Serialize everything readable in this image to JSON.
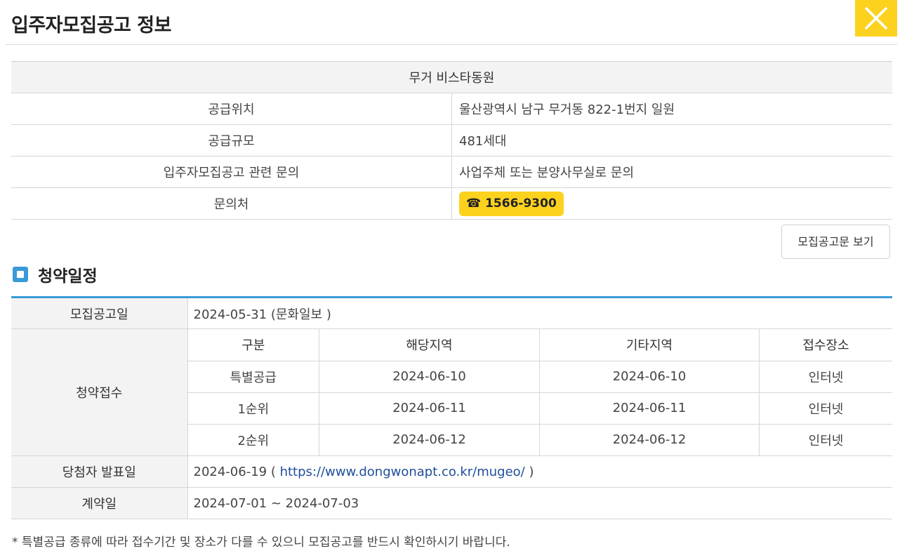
{
  "header": {
    "title": "입주자모집공고 정보",
    "close_icon": "close-icon"
  },
  "info": {
    "complex_name": "무거 비스타동원",
    "rows": [
      {
        "label": "공급위치",
        "value": "울산광역시 남구 무거동 822-1번지 일원"
      },
      {
        "label": "공급규모",
        "value": "481세대"
      },
      {
        "label": "입주자모집공고 관련 문의",
        "value": "사업주체 또는 분양사무실로 문의"
      }
    ],
    "contact_label": "문의처",
    "phone": "☎ 1566-9300"
  },
  "notice_button": "모집공고문 보기",
  "schedule": {
    "section_title": "청약일정",
    "notice_date_label": "모집공고일",
    "notice_date": "2024-05-31 (문화일보 )",
    "application_label": "청약접수",
    "columns": [
      "구분",
      "해당지역",
      "기타지역",
      "접수장소"
    ],
    "rows": [
      [
        "특별공급",
        "2024-06-10",
        "2024-06-10",
        "인터넷"
      ],
      [
        "1순위",
        "2024-06-11",
        "2024-06-11",
        "인터넷"
      ],
      [
        "2순위",
        "2024-06-12",
        "2024-06-12",
        "인터넷"
      ]
    ],
    "winner_label": "당첨자 발표일",
    "winner_date": "2024-06-19 (",
    "winner_url": "https://www.dongwonapt.co.kr/mugeo/",
    "winner_close": ")",
    "contract_label": "계약일",
    "contract_date": "2024-07-01 ~ 2024-07-03"
  },
  "footnote": "* 특별공급 종류에 따라 접수기간 및 장소가 다를 수 있으니 모집공고를 반드시 확인하시기 바랍니다.",
  "colors": {
    "accent_yellow": "#fcd21f",
    "accent_blue": "#3a9ad9",
    "link": "#1f4e9a"
  }
}
